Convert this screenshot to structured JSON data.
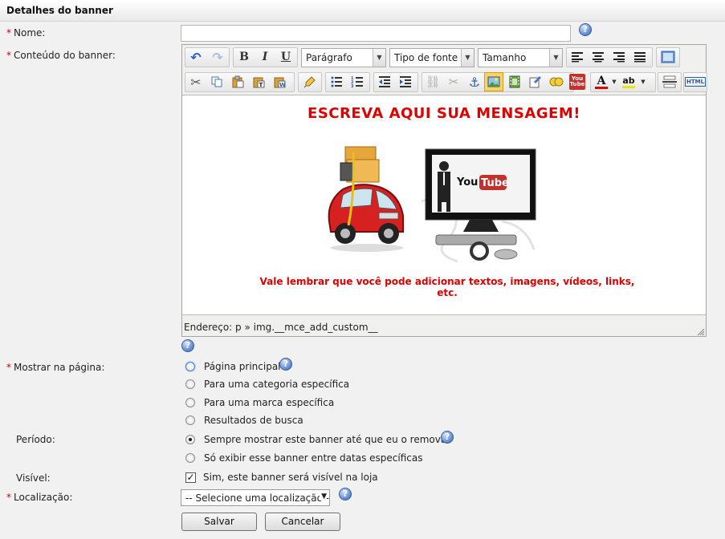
{
  "header": {
    "title": "Detalhes do banner"
  },
  "form": {
    "name_label": "Nome:",
    "name_value": "",
    "content_label": "Conteúdo do banner:",
    "show_label": "Mostrar na página:",
    "period_label": "Período:",
    "visible_label": "Visível:",
    "location_label": "Localização:",
    "required_mark": "*"
  },
  "editor": {
    "format_select": "Parágrafo",
    "font_select": "Tipo de fonte",
    "size_select": "Tamanho",
    "html_label": "HTML",
    "youtube_icon_label": "You Tube",
    "content": {
      "title": "ESCREVA AQUI SUA MENSAGEM!",
      "youtube_text": "You",
      "youtube_tube": "Tube",
      "subtitle": "Vale lembrar que você pode adicionar textos, imagens, vídeos, links, etc."
    },
    "status": "Endereço: p » img.__mce_add_custom__"
  },
  "show_options": [
    {
      "label": "Página principal",
      "selected": false,
      "focused": true
    },
    {
      "label": "Para uma categoria específica",
      "selected": false
    },
    {
      "label": "Para uma marca específica",
      "selected": false
    },
    {
      "label": "Resultados de busca",
      "selected": false
    }
  ],
  "period_options": [
    {
      "label": "Sempre mostrar este banner até que eu o remova",
      "selected": true
    },
    {
      "label": "Só exibir esse banner entre datas específicas",
      "selected": false
    }
  ],
  "visible": {
    "label": "Sim, este banner será visível na loja",
    "checked": true
  },
  "location": {
    "value": "-- Selecione uma localização --"
  },
  "buttons": {
    "save": "Salvar",
    "cancel": "Cancelar"
  },
  "colors": {
    "accent_red": "#e00000",
    "required": "#cc0000",
    "help_blue": "#5b86cf"
  }
}
